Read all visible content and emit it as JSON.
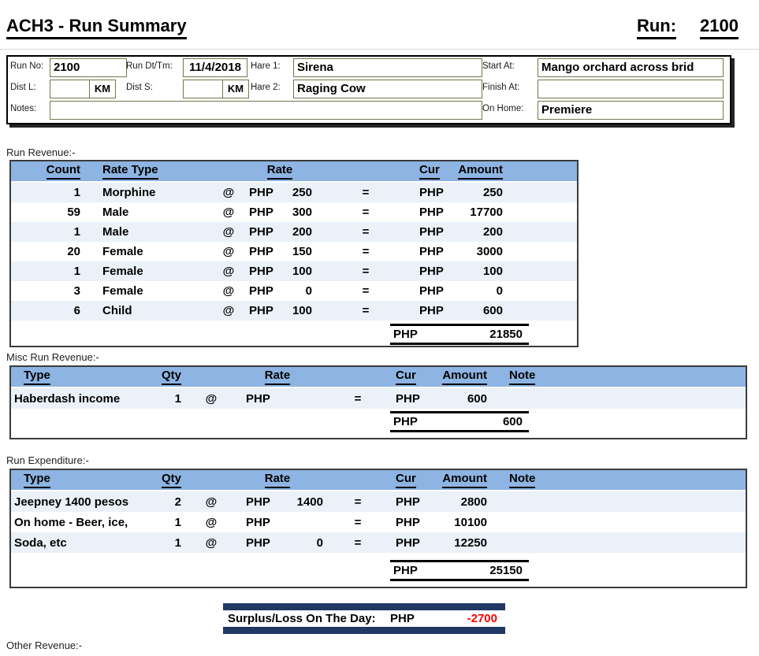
{
  "title": "ACH3 - Run Summary",
  "run": {
    "label": "Run:",
    "number": "2100"
  },
  "form": {
    "run_no": {
      "label": "Run No:",
      "value": "2100"
    },
    "run_dttm": {
      "label": "Run Dt/Tm:",
      "value": "11/4/2018"
    },
    "hare1": {
      "label": "Hare 1:",
      "value": "Sirena"
    },
    "start_at": {
      "label": "Start At:",
      "value": "Mango orchard across brid"
    },
    "dist_l": {
      "label": "Dist L:",
      "value": "",
      "unit": "KM"
    },
    "dist_s": {
      "label": "Dist S:",
      "value": "",
      "unit": "KM"
    },
    "hare2": {
      "label": "Hare 2:",
      "value": "Raging Cow"
    },
    "finish_at": {
      "label": "Finish At:",
      "value": ""
    },
    "notes": {
      "label": "Notes:",
      "value": ""
    },
    "on_home": {
      "label": "On Home:",
      "value": "Premiere"
    }
  },
  "symbols": {
    "at": "@",
    "equals": "="
  },
  "run_revenue": {
    "section_label": "Run Revenue:-",
    "headers": {
      "count": "Count",
      "rate_type": "Rate Type",
      "rate": "Rate",
      "cur": "Cur",
      "amount": "Amount"
    },
    "rows": [
      {
        "count": "1",
        "rate_type": "Morphine",
        "cur1": "PHP",
        "rate": "250",
        "cur2": "PHP",
        "amount": "250"
      },
      {
        "count": "59",
        "rate_type": "Male",
        "cur1": "PHP",
        "rate": "300",
        "cur2": "PHP",
        "amount": "17700"
      },
      {
        "count": "1",
        "rate_type": "Male",
        "cur1": "PHP",
        "rate": "200",
        "cur2": "PHP",
        "amount": "200"
      },
      {
        "count": "20",
        "rate_type": "Female",
        "cur1": "PHP",
        "rate": "150",
        "cur2": "PHP",
        "amount": "3000"
      },
      {
        "count": "1",
        "rate_type": "Female",
        "cur1": "PHP",
        "rate": "100",
        "cur2": "PHP",
        "amount": "100"
      },
      {
        "count": "3",
        "rate_type": "Female",
        "cur1": "PHP",
        "rate": "0",
        "cur2": "PHP",
        "amount": "0"
      },
      {
        "count": "6",
        "rate_type": "Child",
        "cur1": "PHP",
        "rate": "100",
        "cur2": "PHP",
        "amount": "600"
      }
    ],
    "total": {
      "cur": "PHP",
      "amount": "21850"
    }
  },
  "misc_revenue": {
    "section_label": "Misc Run Revenue:-",
    "headers": {
      "type": "Type",
      "qty": "Qty",
      "rate": "Rate",
      "cur": "Cur",
      "amount": "Amount",
      "note": "Note"
    },
    "rows": [
      {
        "type": "Haberdash income",
        "qty": "1",
        "cur1": "PHP",
        "rate": "",
        "cur2": "PHP",
        "amount": "600",
        "note": ""
      }
    ],
    "total": {
      "cur": "PHP",
      "amount": "600"
    }
  },
  "expenditure": {
    "section_label": "Run Expenditure:-",
    "headers": {
      "type": "Type",
      "qty": "Qty",
      "rate": "Rate",
      "cur": "Cur",
      "amount": "Amount",
      "note": "Note"
    },
    "rows": [
      {
        "type": "Jeepney 1400 pesos",
        "qty": "2",
        "cur1": "PHP",
        "rate": "1400",
        "cur2": "PHP",
        "amount": "2800",
        "note": ""
      },
      {
        "type": "On home - Beer, ice,",
        "qty": "1",
        "cur1": "PHP",
        "rate": "",
        "cur2": "PHP",
        "amount": "10100",
        "note": ""
      },
      {
        "type": "Soda, etc",
        "qty": "1",
        "cur1": "PHP",
        "rate": "0",
        "cur2": "PHP",
        "amount": "12250",
        "note": ""
      }
    ],
    "total": {
      "cur": "PHP",
      "amount": "25150"
    }
  },
  "surplus": {
    "label": "Surplus/Loss On The Day:",
    "cur": "PHP",
    "amount": "-2700"
  },
  "other_revenue": {
    "section_label": "Other Revenue:-"
  },
  "colors": {
    "header_band": "#8DB4E2",
    "row_stripe": "#EAF1F9",
    "navy_bar": "#1F3864",
    "negative_value": "#FF0000",
    "field_border": "#76764E"
  }
}
